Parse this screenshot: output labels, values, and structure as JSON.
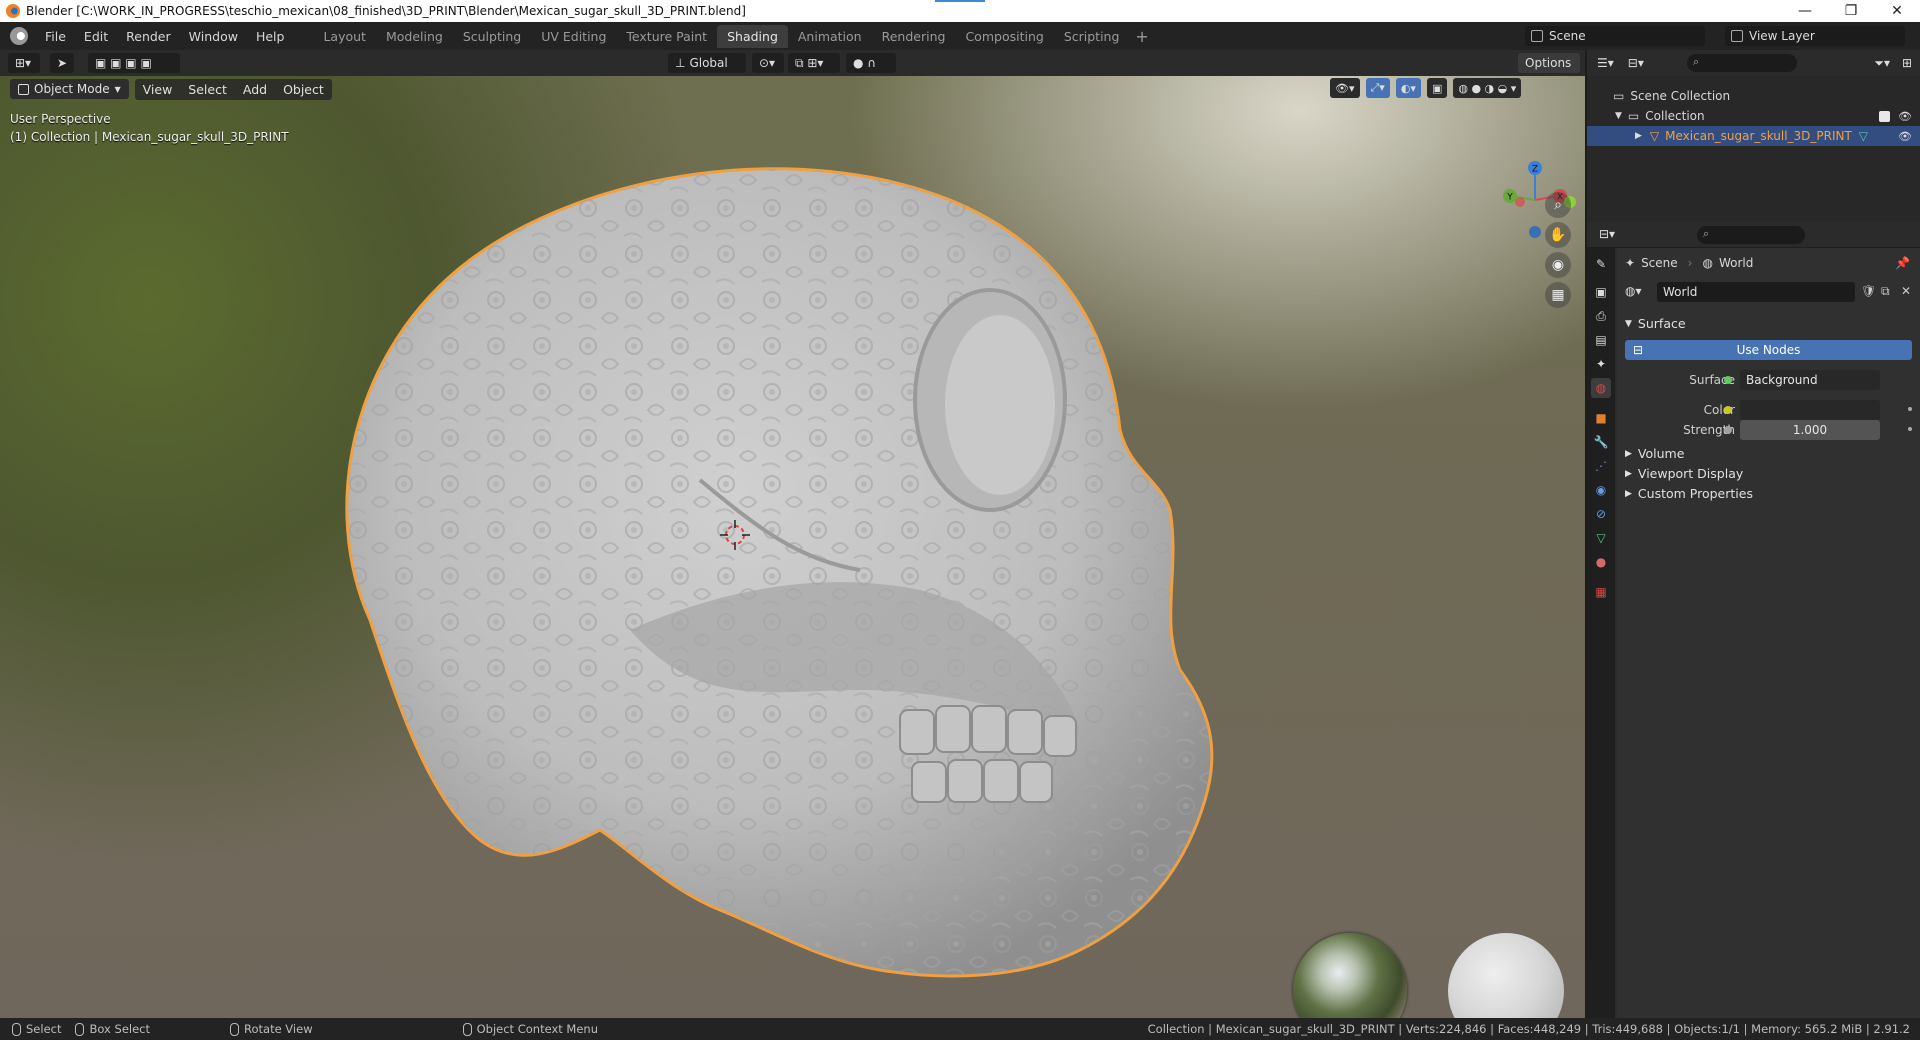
{
  "window": {
    "title": "Blender [C:\\WORK_IN_PROGRESS\\teschio_mexican\\08_finished\\3D_PRINT\\Blender\\Mexican_sugar_skull_3D_PRINT.blend]",
    "controls": [
      "—",
      "❐",
      "✕"
    ]
  },
  "menubar": {
    "menus": [
      "File",
      "Edit",
      "Render",
      "Window",
      "Help"
    ],
    "workspaces": [
      "Layout",
      "Modeling",
      "Sculpting",
      "UV Editing",
      "Texture Paint",
      "Shading",
      "Animation",
      "Rendering",
      "Compositing",
      "Scripting"
    ],
    "active_workspace": "Shading",
    "add_workspace": "+",
    "scene": "Scene",
    "view_layer": "View Layer"
  },
  "viewport_header": {
    "orientation": "Global",
    "options": "Options",
    "mode": "Object Mode",
    "menus": [
      "View",
      "Select",
      "Add",
      "Object"
    ]
  },
  "viewport": {
    "perspective": "User Perspective",
    "collection_info": "(1) Collection | Mexican_sugar_skull_3D_PRINT",
    "gizmo_axes": [
      "Z",
      "Y",
      "X"
    ]
  },
  "outliner": {
    "root": "Scene Collection",
    "collection": "Collection",
    "object": "Mexican_sugar_skull_3D_PRINT"
  },
  "properties": {
    "breadcrumb_scene": "Scene",
    "breadcrumb_world": "World",
    "world_name": "World",
    "surface_panel": "Surface",
    "use_nodes": "Use Nodes",
    "surface_label": "Surface",
    "surface_value": "Background",
    "color_label": "Color",
    "strength_label": "Strength",
    "strength_value": "1.000",
    "panels_collapsed": [
      "Volume",
      "Viewport Display",
      "Custom Properties"
    ],
    "colors": {
      "surface_socket": "#63c763",
      "color_socket": "#c7c729",
      "strength_socket": "#a1a1a1",
      "color_swatch": "#282828"
    }
  },
  "statusbar": {
    "select": "Select",
    "box_select": "Box Select",
    "rotate_view": "Rotate View",
    "context_menu": "Object Context Menu",
    "stats": "Collection | Mexican_sugar_skull_3D_PRINT | Verts:224,846 | Faces:448,249 | Tris:449,688 | Objects:1/1 | Memory: 565.2 MiB | 2.91.2"
  },
  "colors": {
    "accent": "#4772b3",
    "selection_outline": "#f0a040",
    "panel_bg": "#303030",
    "header_bg": "#2b2b2b"
  }
}
